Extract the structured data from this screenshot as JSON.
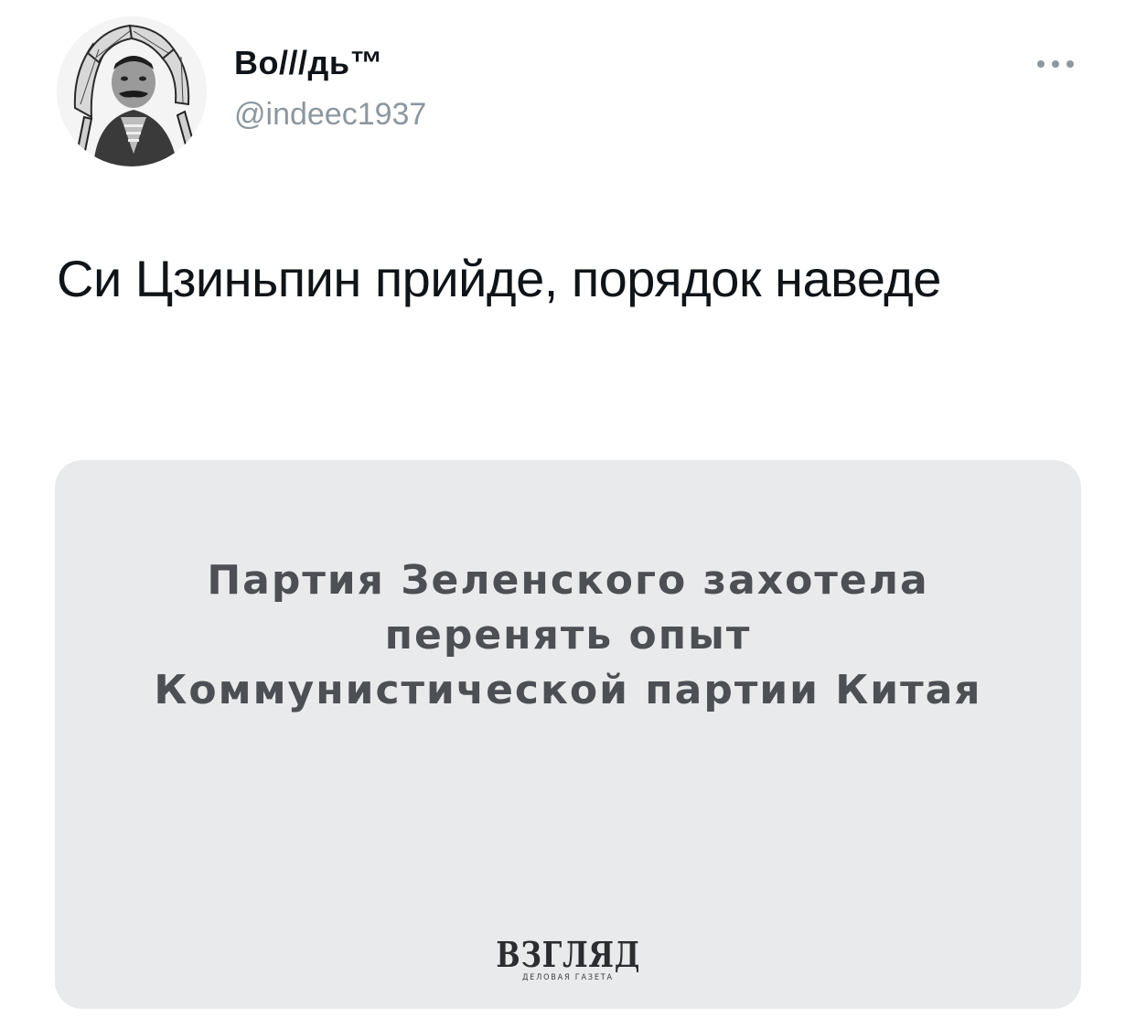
{
  "tweet": {
    "author": {
      "display_name": "Во///дь™",
      "handle": "@indeec1937",
      "avatar_icon": "avatar-portrait-headdress"
    },
    "more_icon": "more-horizontal-icon",
    "text": "Си Цзиньпин прийде, порядок наведе"
  },
  "media": {
    "headline_lines": [
      "Партия Зеленского захотела",
      "перенять опыт",
      "Коммунистической партии Китая"
    ],
    "brand": {
      "logo": "ВЗГЛЯД",
      "subtitle": "ДЕЛОВАЯ ГАЗЕТА"
    },
    "background_color": "#e9eaec"
  },
  "colors": {
    "text_primary": "#0f1419",
    "text_secondary": "#8c979f",
    "headline_text": "#4c4f53"
  }
}
